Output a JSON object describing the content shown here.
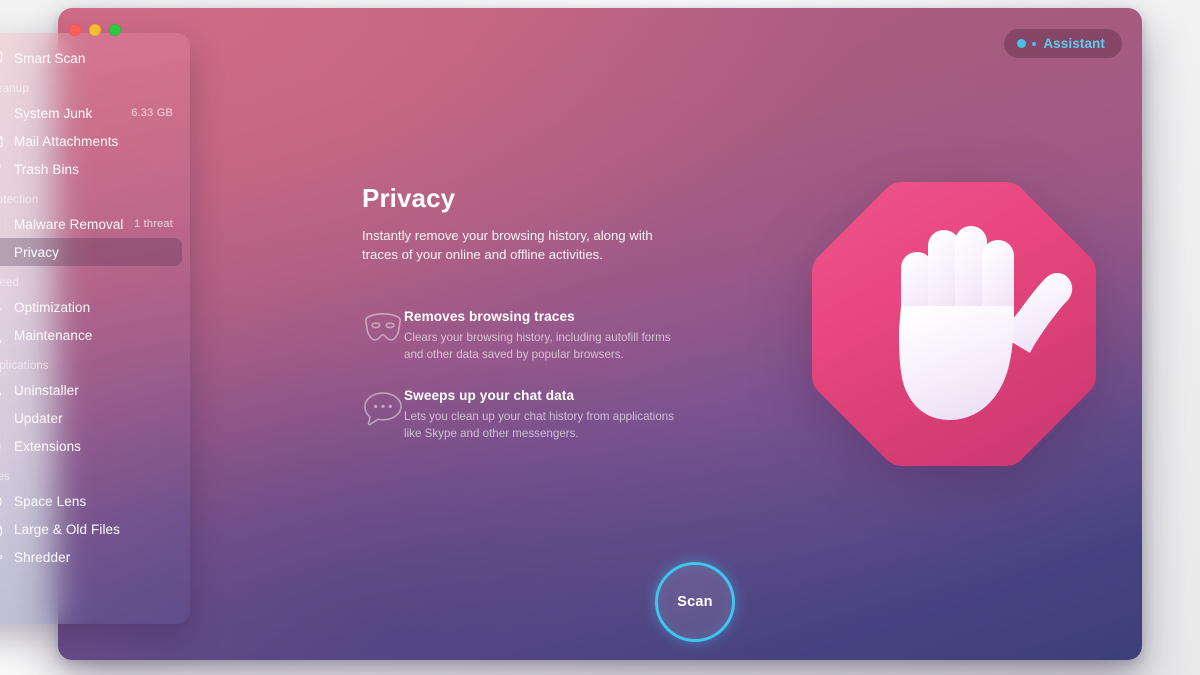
{
  "window": {
    "traffic_lights": [
      "close",
      "minimize",
      "zoom"
    ]
  },
  "assistant": {
    "label": "Assistant"
  },
  "sidebar": {
    "groups": [
      {
        "title": null,
        "items": [
          {
            "label": "Smart Scan",
            "icon": "monitor-icon",
            "badge": null,
            "selected": false
          }
        ]
      },
      {
        "title": "Cleanup",
        "items": [
          {
            "label": "System Junk",
            "icon": "brush-icon",
            "badge": "6.33 GB",
            "selected": false
          },
          {
            "label": "Mail Attachments",
            "icon": "envelope-icon",
            "badge": null,
            "selected": false
          },
          {
            "label": "Trash Bins",
            "icon": "trash-icon",
            "badge": null,
            "selected": false
          }
        ]
      },
      {
        "title": "Protection",
        "items": [
          {
            "label": "Malware Removal",
            "icon": "biohazard-icon",
            "badge": "1 threat",
            "selected": false
          },
          {
            "label": "Privacy",
            "icon": "hand-icon",
            "badge": null,
            "selected": true
          }
        ]
      },
      {
        "title": "Speed",
        "items": [
          {
            "label": "Optimization",
            "icon": "sliders-icon",
            "badge": null,
            "selected": false
          },
          {
            "label": "Maintenance",
            "icon": "wrench-icon",
            "badge": null,
            "selected": false
          }
        ]
      },
      {
        "title": "Applications",
        "items": [
          {
            "label": "Uninstaller",
            "icon": "app-tree-icon",
            "badge": null,
            "selected": false
          },
          {
            "label": "Updater",
            "icon": "refresh-icon",
            "badge": null,
            "selected": false
          },
          {
            "label": "Extensions",
            "icon": "puzzle-icon",
            "badge": null,
            "selected": false
          }
        ]
      },
      {
        "title": "Files",
        "items": [
          {
            "label": "Space Lens",
            "icon": "planet-icon",
            "badge": null,
            "selected": false
          },
          {
            "label": "Large & Old Files",
            "icon": "folder-icon",
            "badge": null,
            "selected": false
          },
          {
            "label": "Shredder",
            "icon": "shredder-icon",
            "badge": null,
            "selected": false
          }
        ]
      }
    ]
  },
  "main": {
    "title": "Privacy",
    "subtitle": "Instantly remove your browsing history, along with traces of your online and offline activities.",
    "features": [
      {
        "icon": "mask-icon",
        "title": "Removes browsing traces",
        "desc": "Clears your browsing history, including autofill forms and other data saved by popular browsers."
      },
      {
        "icon": "chat-bubble-icon",
        "title": "Sweeps up your chat data",
        "desc": "Lets you clean up your chat history from applications like Skype and other messengers."
      }
    ],
    "hero_icon": "stop-hand-octagon-icon",
    "scan_label": "Scan"
  },
  "colors": {
    "accent_cyan": "#3ec6f0",
    "hero_pink": "#e8467f",
    "hand_white": "#f7f0fb",
    "bg_top": "#c3677f",
    "bg_bottom": "#3b4079"
  }
}
